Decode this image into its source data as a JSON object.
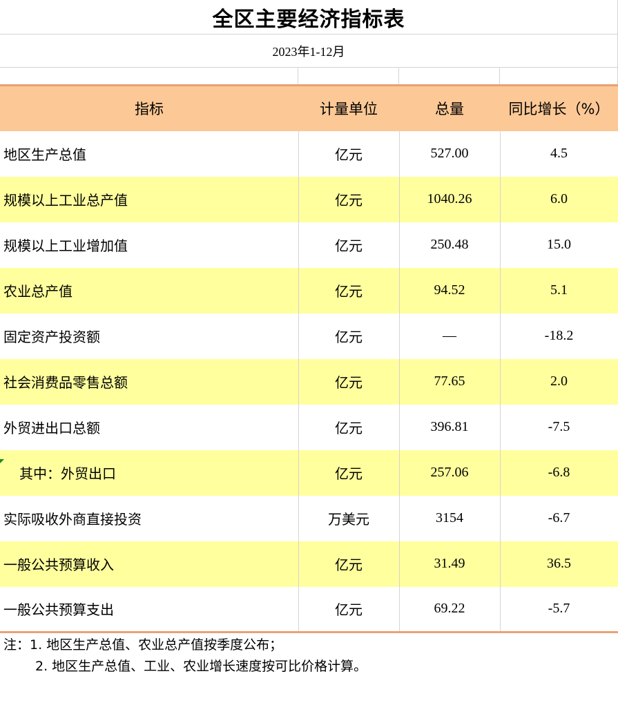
{
  "title": "全区主要经济指标表",
  "period": "2023年1-12月",
  "columns": [
    "指标",
    "计量单位",
    "总量",
    "同比增长（%）"
  ],
  "rows": [
    {
      "name": "地区生产总值",
      "unit": "亿元",
      "total": "527.00",
      "growth": "4.5"
    },
    {
      "name": "规模以上工业总产值",
      "unit": "亿元",
      "total": "1040.26",
      "growth": "6.0"
    },
    {
      "name": "规模以上工业增加值",
      "unit": "亿元",
      "total": "250.48",
      "growth": "15.0"
    },
    {
      "name": "农业总产值",
      "unit": "亿元",
      "total": "94.52",
      "growth": "5.1"
    },
    {
      "name": "固定资产投资额",
      "unit": "亿元",
      "total": "—",
      "growth": "-18.2"
    },
    {
      "name": "社会消费品零售总额",
      "unit": "亿元",
      "total": "77.65",
      "growth": "2.0"
    },
    {
      "name": "外贸进出口总额",
      "unit": "亿元",
      "total": "396.81",
      "growth": "-7.5"
    },
    {
      "name": "其中：外贸出口",
      "unit": "亿元",
      "total": "257.06",
      "growth": "-6.8"
    },
    {
      "name": "实际吸收外商直接投资",
      "unit": "万美元",
      "total": "3154",
      "growth": "-6.7"
    },
    {
      "name": "一般公共预算收入",
      "unit": "亿元",
      "total": "31.49",
      "growth": "36.5"
    },
    {
      "name": "一般公共预算支出",
      "unit": "亿元",
      "total": "69.22",
      "growth": "-5.7"
    }
  ],
  "notes": [
    "注：1. 地区生产总值、农业总产值按季度公布；",
    "2. 地区生产总值、工业、农业增长速度按可比价格计算。"
  ],
  "colors": {
    "header_bg": "#fcc896",
    "highlight_row": "#ffff9e",
    "accent_border": "#e8a274"
  }
}
